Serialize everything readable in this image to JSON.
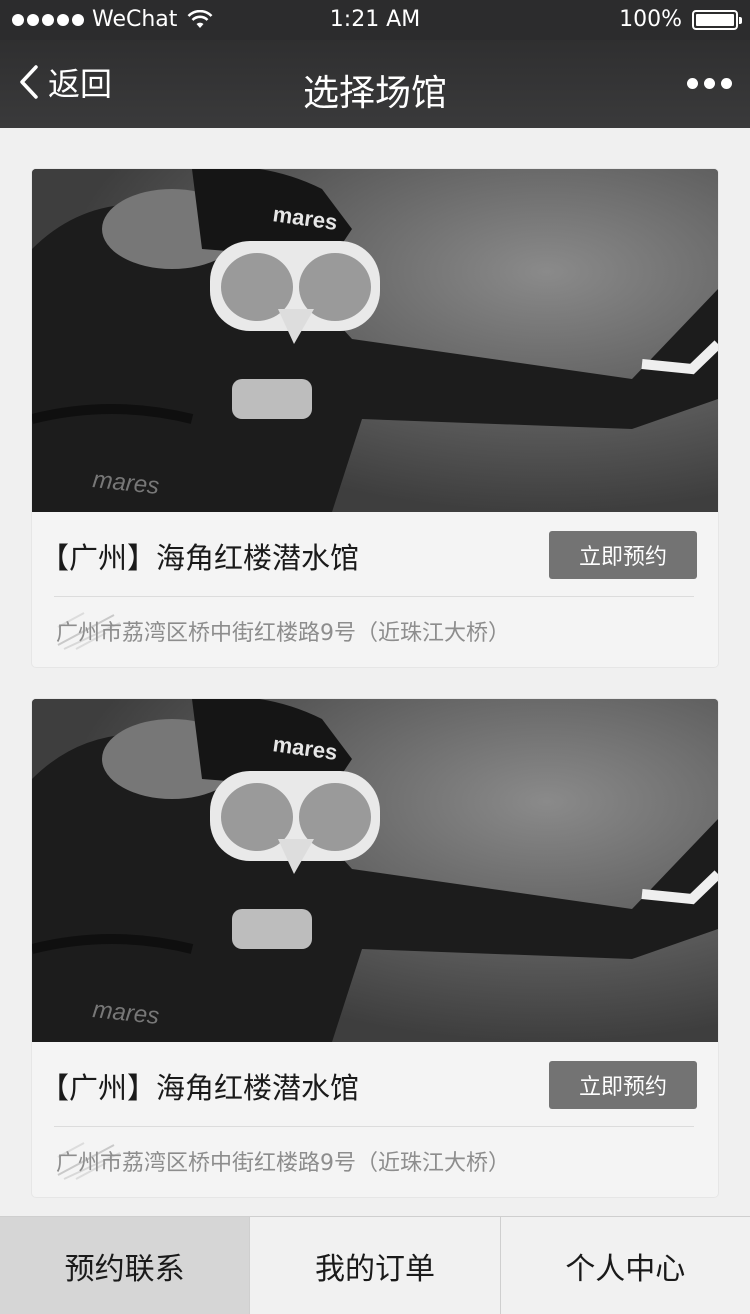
{
  "status_bar": {
    "carrier": "WeChat",
    "time": "1:21 AM",
    "battery": "100%"
  },
  "nav": {
    "back_label": "返回",
    "title": "选择场馆"
  },
  "venues": [
    {
      "name": "【广州】海角红楼潜水馆",
      "button": "立即预约",
      "address": "广州市荔湾区桥中街红楼路9号（近珠江大桥）",
      "photo_text": "mares"
    },
    {
      "name": "【广州】海角红楼潜水馆",
      "button": "立即预约",
      "address": "广州市荔湾区桥中街红楼路9号（近珠江大桥）",
      "photo_text": "mares"
    }
  ],
  "tabs": [
    {
      "label": "预约联系",
      "active": true
    },
    {
      "label": "我的订单",
      "active": false
    },
    {
      "label": "个人中心",
      "active": false
    }
  ],
  "icons": {
    "back": "chevron-left-icon",
    "more": "more-dots-icon",
    "wifi": "wifi-icon",
    "battery": "battery-icon",
    "location": "location-icon"
  }
}
